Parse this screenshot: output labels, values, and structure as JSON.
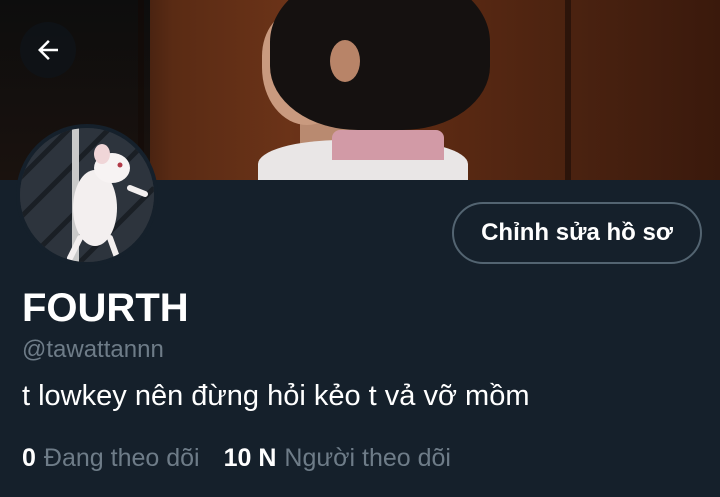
{
  "header": {
    "back_icon": "arrow-left-icon",
    "banner_desc": "banner-photo"
  },
  "profile": {
    "avatar_icon": "avatar",
    "edit_button_label": "Chỉnh sửa hồ sơ",
    "display_name": "FOURTH",
    "handle": "@tawattannn",
    "bio": "t lowkey nên đừng hỏi kẻo t vả vỡ mồm",
    "following_count": "0",
    "following_label": "Đang theo dõi",
    "followers_count": "10 N",
    "followers_label": "Người theo dõi"
  },
  "colors": {
    "background": "#15202b",
    "muted_text": "#6e7c88",
    "button_border": "#536471"
  }
}
